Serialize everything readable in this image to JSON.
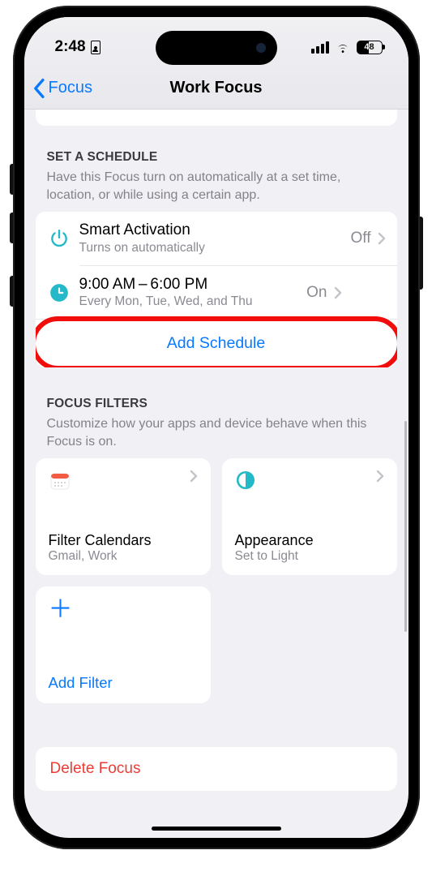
{
  "status": {
    "time": "2:48",
    "battery_pct": "48"
  },
  "nav": {
    "back_label": "Focus",
    "title": "Work Focus"
  },
  "schedule": {
    "header": "SET A SCHEDULE",
    "caption": "Have this Focus turn on automatically at a set time, location, or while using a certain app.",
    "smart": {
      "title": "Smart Activation",
      "sub": "Turns on automatically",
      "state": "Off"
    },
    "time": {
      "title": "9:00 AM – 6:00 PM",
      "sub": "Every Mon, Tue, Wed, and Thu",
      "state": "On"
    },
    "add_label": "Add Schedule"
  },
  "filters": {
    "header": "FOCUS FILTERS",
    "caption": "Customize how your apps and device behave when this Focus is on.",
    "items": [
      {
        "title": "Filter Calendars",
        "sub": "Gmail, Work"
      },
      {
        "title": "Appearance",
        "sub": "Set to Light"
      }
    ],
    "add_label": "Add Filter"
  },
  "delete_label": "Delete Focus"
}
